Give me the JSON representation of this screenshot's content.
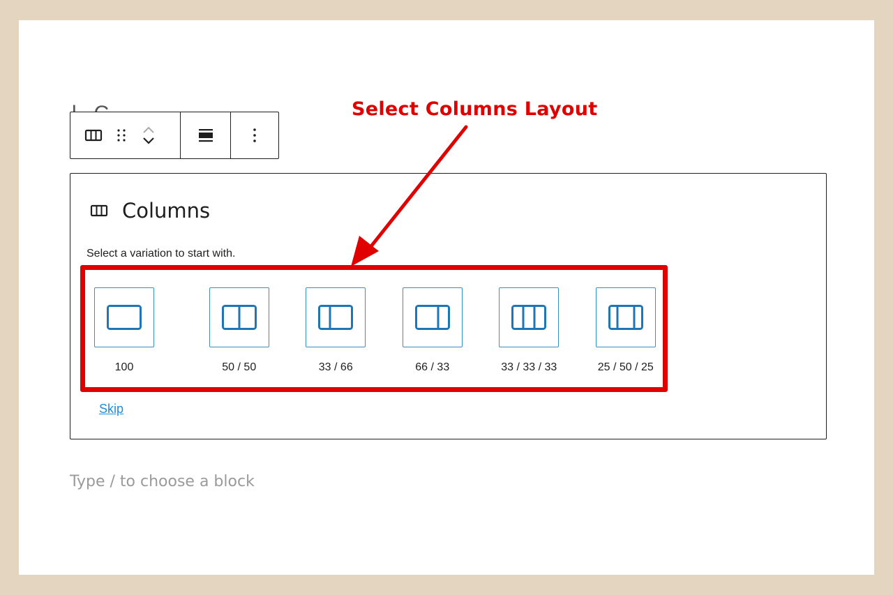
{
  "editor": {
    "placeholder_block": {
      "title": "Columns",
      "instructions": "Select a variation to start with.",
      "variations": [
        {
          "label": "100",
          "icon": "column-100-icon",
          "columns": [
            100
          ]
        },
        {
          "label": "50 / 50",
          "icon": "column-50-50-icon",
          "columns": [
            50,
            50
          ]
        },
        {
          "label": "33 / 66",
          "icon": "column-33-66-icon",
          "columns": [
            33,
            66
          ]
        },
        {
          "label": "66 / 33",
          "icon": "column-66-33-icon",
          "columns": [
            66,
            33
          ]
        },
        {
          "label": "33 / 33 / 33",
          "icon": "column-33-33-33-icon",
          "columns": [
            33,
            33,
            33
          ]
        },
        {
          "label": "25 / 50 / 25",
          "icon": "column-25-50-25-icon",
          "columns": [
            25,
            50,
            25
          ]
        }
      ],
      "skip_label": "Skip"
    },
    "appender_placeholder": "Type / to choose a block",
    "toolbar": {
      "icons": [
        "columns-icon",
        "drag-handle-icon",
        "move-up-icon",
        "move-down-icon",
        "align-icon",
        "more-options-icon"
      ]
    }
  },
  "annotation": {
    "text": "Select Columns Layout"
  },
  "colors": {
    "accent": "#e00000",
    "wp_blue": "#3b8ec4",
    "background": "#e4d5c1"
  }
}
